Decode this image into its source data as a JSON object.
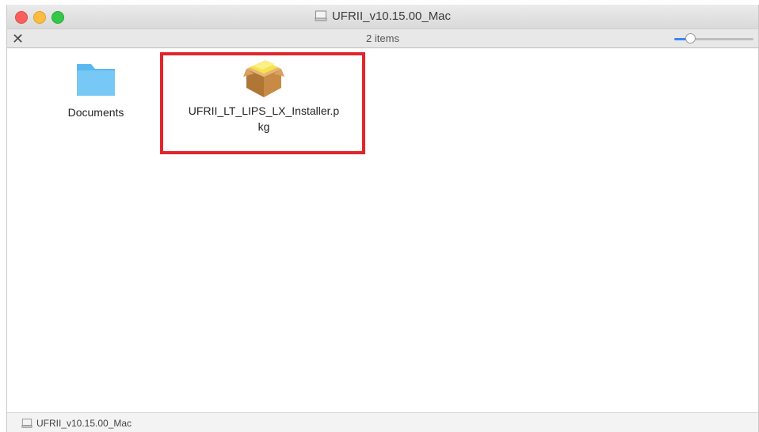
{
  "window": {
    "title": "UFRII_v10.15.00_Mac",
    "title_icon": "disk-image-icon"
  },
  "toolbar": {
    "item_count": "2 items",
    "icon_size_level": 0.2
  },
  "files": [
    {
      "name": "Documents",
      "icon": "folder-icon"
    },
    {
      "name": "UFRII_LT_LIPS_LX_Installer.p\nkg",
      "icon": "package-icon"
    }
  ],
  "footer": {
    "path": "UFRII_v10.15.00_Mac"
  },
  "colors": {
    "highlight": "#e0262c",
    "folder": "#5ab8f0",
    "slider_accent": "#3b87f5"
  }
}
